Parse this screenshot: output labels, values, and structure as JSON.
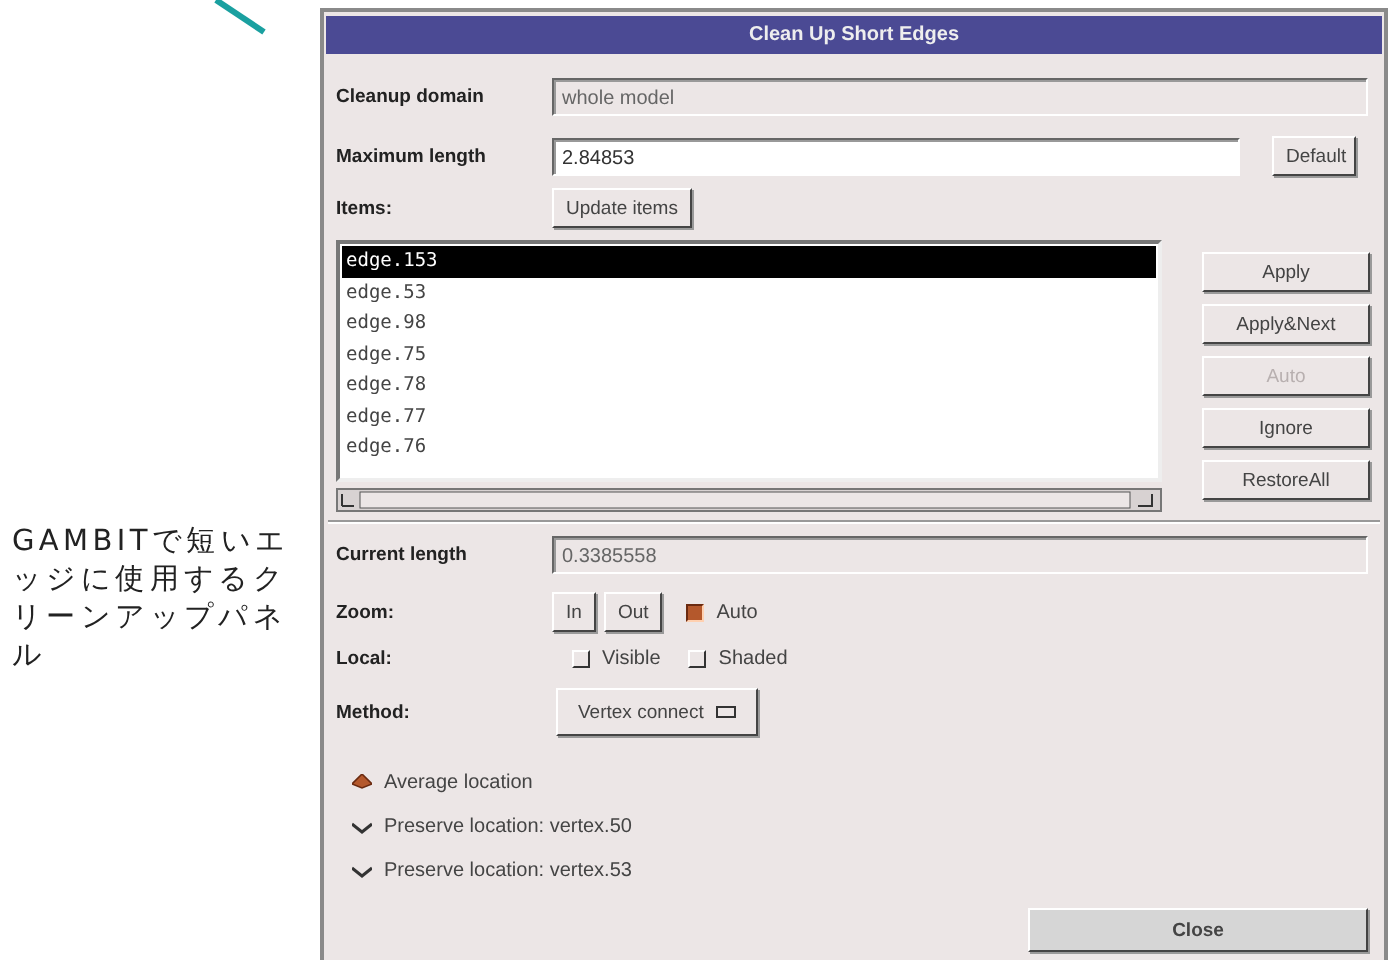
{
  "caption": "GAMBITで短いエッジに使用するクリーンアップパネル",
  "window": {
    "title": "Clean Up Short Edges"
  },
  "cleanup_domain": {
    "label": "Cleanup domain",
    "value": "whole model"
  },
  "maximum_length": {
    "label": "Maximum length",
    "value": "2.84853",
    "button": "Default"
  },
  "items": {
    "label": "Items:",
    "button": "Update items",
    "list": [
      {
        "text": "edge.153",
        "selected": true
      },
      {
        "text": "edge.53",
        "selected": false
      },
      {
        "text": "edge.98",
        "selected": false
      },
      {
        "text": "edge.75",
        "selected": false
      },
      {
        "text": "edge.78",
        "selected": false
      },
      {
        "text": "edge.77",
        "selected": false
      },
      {
        "text": "edge.76",
        "selected": false
      }
    ],
    "actions": [
      {
        "label": "Apply",
        "disabled": false
      },
      {
        "label": "Apply&Next",
        "disabled": false
      },
      {
        "label": "Auto",
        "disabled": true
      },
      {
        "label": "Ignore",
        "disabled": false
      },
      {
        "label": "RestoreAll",
        "disabled": false
      }
    ]
  },
  "current_length": {
    "label": "Current length",
    "value": "0.3385558"
  },
  "zoom": {
    "label": "Zoom:",
    "buttons": [
      "In",
      "Out"
    ],
    "auto": {
      "label": "Auto",
      "checked": true
    }
  },
  "local": {
    "label": "Local:",
    "options": [
      {
        "label": "Visible",
        "checked": false
      },
      {
        "label": "Shaded",
        "checked": false
      }
    ]
  },
  "method": {
    "label": "Method:",
    "value": "Vertex connect"
  },
  "locations": [
    {
      "label": "Average location",
      "selected": true
    },
    {
      "label": "Preserve location: vertex.50",
      "selected": false
    },
    {
      "label": "Preserve location: vertex.53",
      "selected": false
    }
  ],
  "close_button": "Close"
}
